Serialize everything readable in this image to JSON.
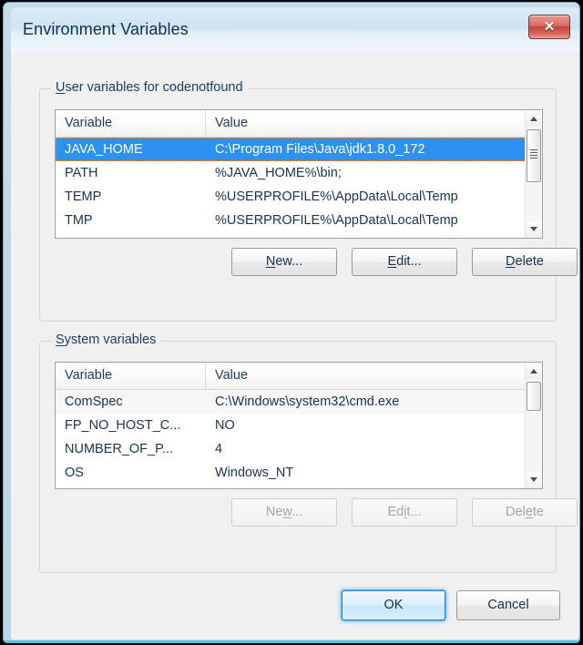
{
  "window": {
    "title": "Environment Variables",
    "close_icon": "close-icon",
    "close_glyph": "✕"
  },
  "user_section": {
    "legend_prefix": "U",
    "legend_rest": "ser variables for codenotfound",
    "columns": [
      "Variable",
      "Value"
    ],
    "rows": [
      {
        "variable": "JAVA_HOME",
        "value": "C:\\Program Files\\Java\\jdk1.8.0_172",
        "selected": true
      },
      {
        "variable": "PATH",
        "value": "%JAVA_HOME%\\bin;",
        "selected": false
      },
      {
        "variable": "TEMP",
        "value": "%USERPROFILE%\\AppData\\Local\\Temp",
        "selected": false
      },
      {
        "variable": "TMP",
        "value": "%USERPROFILE%\\AppData\\Local\\Temp",
        "selected": false
      }
    ],
    "buttons": {
      "new": {
        "pre": "N",
        "accel": "N",
        "post": "ew...",
        "label": "New...",
        "enabled": true
      },
      "edit": {
        "pre": "",
        "accel": "E",
        "post": "dit...",
        "label": "Edit...",
        "enabled": true
      },
      "delete": {
        "pre": "",
        "accel": "D",
        "post": "elete",
        "label": "Delete",
        "enabled": true
      }
    }
  },
  "system_section": {
    "legend_prefix": "S",
    "legend_rest": "ystem variables",
    "columns": [
      "Variable",
      "Value"
    ],
    "rows": [
      {
        "variable": "ComSpec",
        "value": "C:\\Windows\\system32\\cmd.exe",
        "alt": true
      },
      {
        "variable": "FP_NO_HOST_C...",
        "value": "NO",
        "alt": false
      },
      {
        "variable": "NUMBER_OF_P...",
        "value": "4",
        "alt": false
      },
      {
        "variable": "OS",
        "value": "Windows_NT",
        "alt": false
      }
    ],
    "buttons": {
      "new": {
        "before": "Ne",
        "accel": "w",
        "after": "...",
        "label": "New...",
        "enabled": false
      },
      "edit": {
        "before": "Ed",
        "accel": "i",
        "after": "t...",
        "label": "Edit...",
        "enabled": false
      },
      "delete": {
        "before": "Del",
        "accel": "e",
        "after": "te",
        "label": "Delete",
        "enabled": false
      }
    }
  },
  "footer": {
    "ok_label": "OK",
    "cancel_label": "Cancel"
  },
  "colors": {
    "selection": "#2b92f2",
    "close_button": "#c4453c",
    "title_text": "#12304e",
    "dialog_bg": "#f0f0f0",
    "frame": "#bcd6e8"
  },
  "scrollbars": {
    "up_arrow_icon": "chevron-up-icon",
    "down_arrow_icon": "chevron-down-icon"
  }
}
